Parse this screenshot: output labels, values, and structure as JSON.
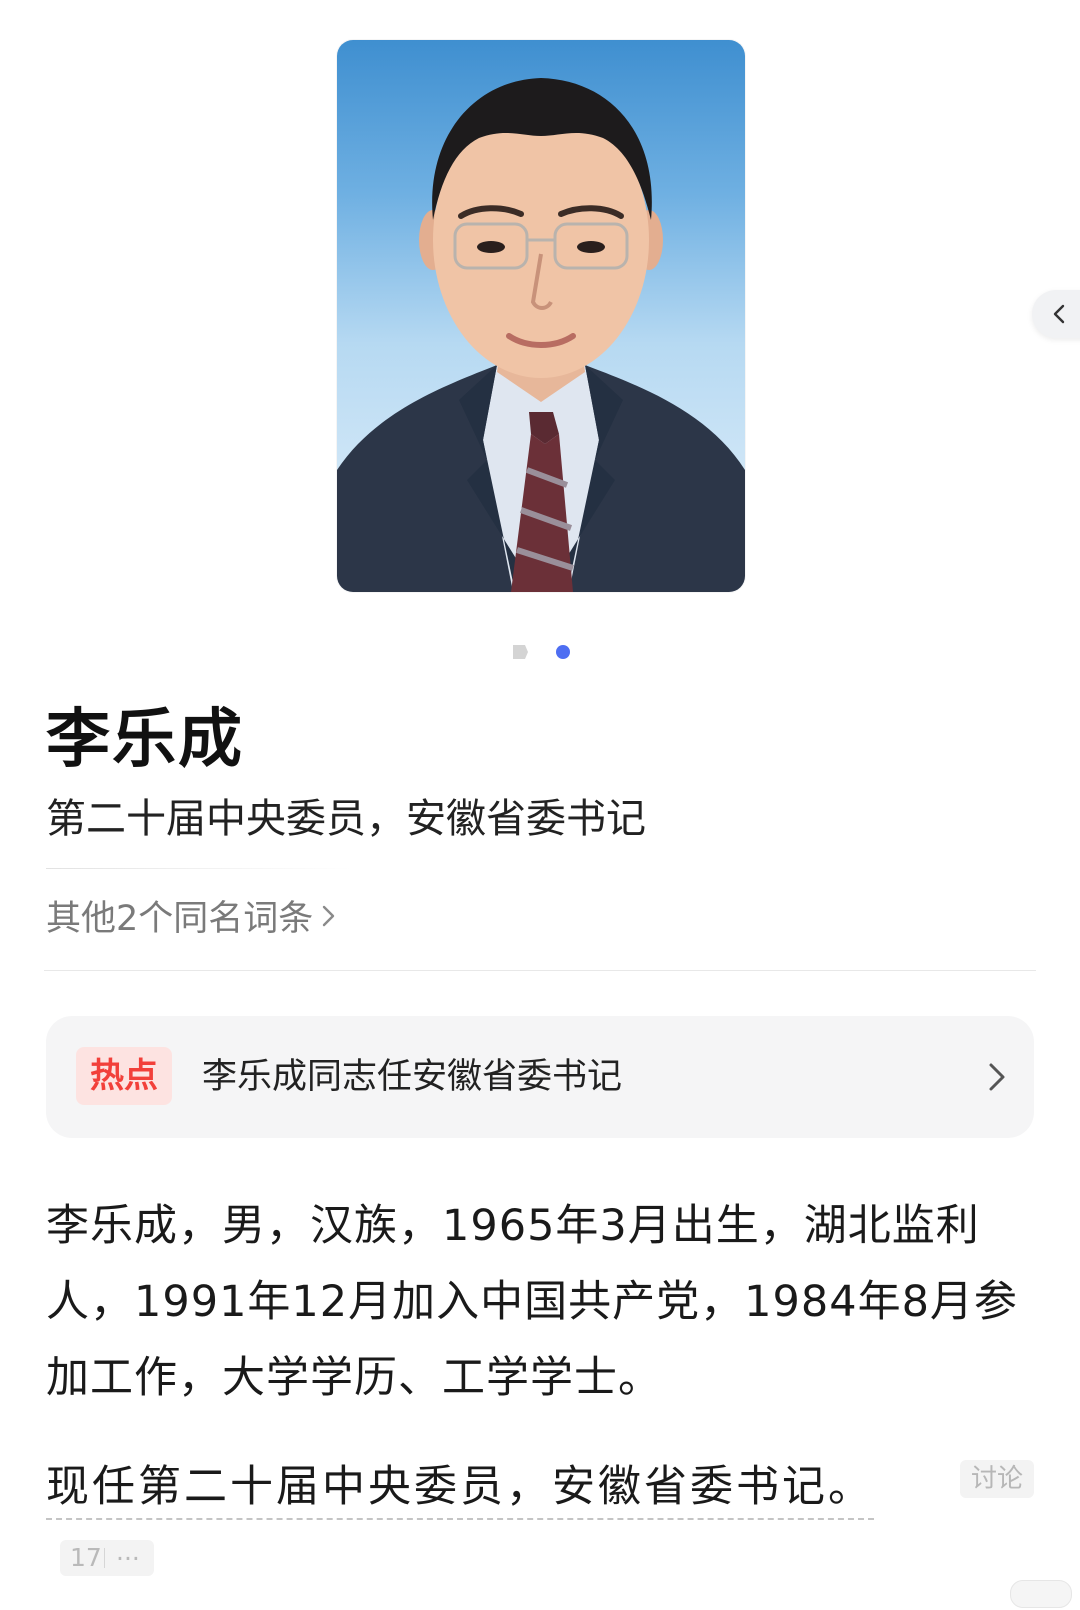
{
  "profile": {
    "name": "李乐成",
    "subtitle": "第二十届中央委员，安徽省委书记",
    "same_name_link": "其他2个同名词条"
  },
  "hot_card": {
    "tag": "热点",
    "text": "李乐成同志任安徽省委书记"
  },
  "intro_text": "李乐成，男，汉族，1965年3月出生，湖北监利人，1991年12月加入中国共产党，1984年8月参加工作，大学学历、工学学士。",
  "current_text": "现任第二十届中央委员，安徽省委书记。",
  "discuss_label": "讨论",
  "reference": {
    "count": "17",
    "more": "..."
  },
  "pager": {
    "total": 2,
    "active_index": 1
  },
  "colors": {
    "accent": "#4e6ef2",
    "hot_tag_text": "#f2403a",
    "hot_tag_bg": "#fde3e1",
    "card_bg": "#f5f5f6"
  },
  "icons": {
    "side": "chevron-left-icon",
    "link": "chevron-right-icon",
    "video_dot": "play-icon"
  }
}
